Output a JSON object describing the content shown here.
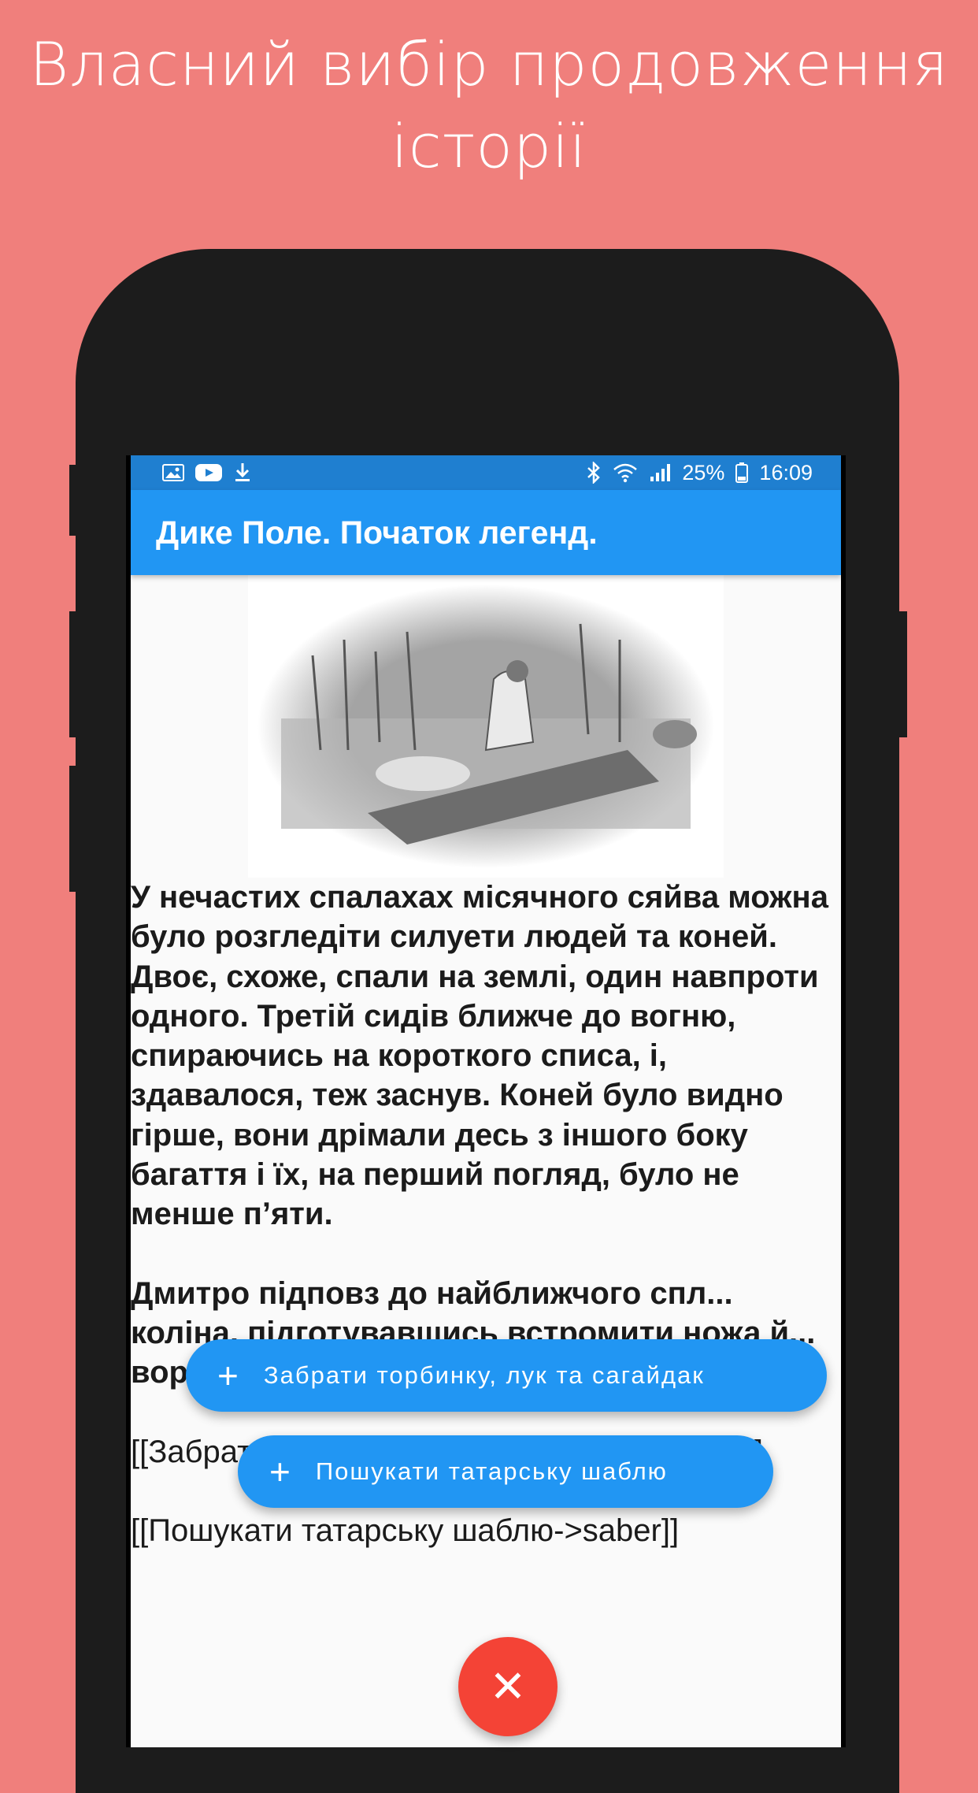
{
  "promo": {
    "headline_line1": "Власний вибір продовження",
    "headline_line2": "історії"
  },
  "statusbar": {
    "left_icons": [
      "image-icon",
      "youtube-icon",
      "download-icon"
    ],
    "right_icons": [
      "bluetooth-icon",
      "wifi-icon",
      "signal-icon",
      "battery-icon"
    ],
    "battery": "25%",
    "time": "16:09"
  },
  "appbar": {
    "title": "Дике Поле. Початок легенд."
  },
  "story": {
    "paragraph1": "У нечастих спалахах місячного сяйва можна було розгледіти силуети людей та коней. Двоє, схоже, спали на землі, один навпроти одного. Третій сидів ближче до вогню, спираючись на короткого списа, і, здавалося, теж заснув. Коней було видно гірше, вони дрімали десь з іншого боку багаття і їх, на перший погляд, було не менше п’яти.",
    "paragraph2": "Дмитро підповз до найближчого спл... коліна, підготувавшись встромити ножа й... ворухн... сагайдаком та якась торбинка.",
    "link1": "[[Забрати торбинку, лук та сагайдак->steal]]",
    "link2": "[[Пошукати татарську шаблю->saber]]"
  },
  "choices": [
    {
      "label": "Забрати торбинку, лук та сагайдак"
    },
    {
      "label": "Пошукати татарську шаблю"
    }
  ],
  "colors": {
    "background": "#F07F7C",
    "primary": "#2196F3",
    "statusbar": "#1f7fd0",
    "accent": "#F44336"
  }
}
